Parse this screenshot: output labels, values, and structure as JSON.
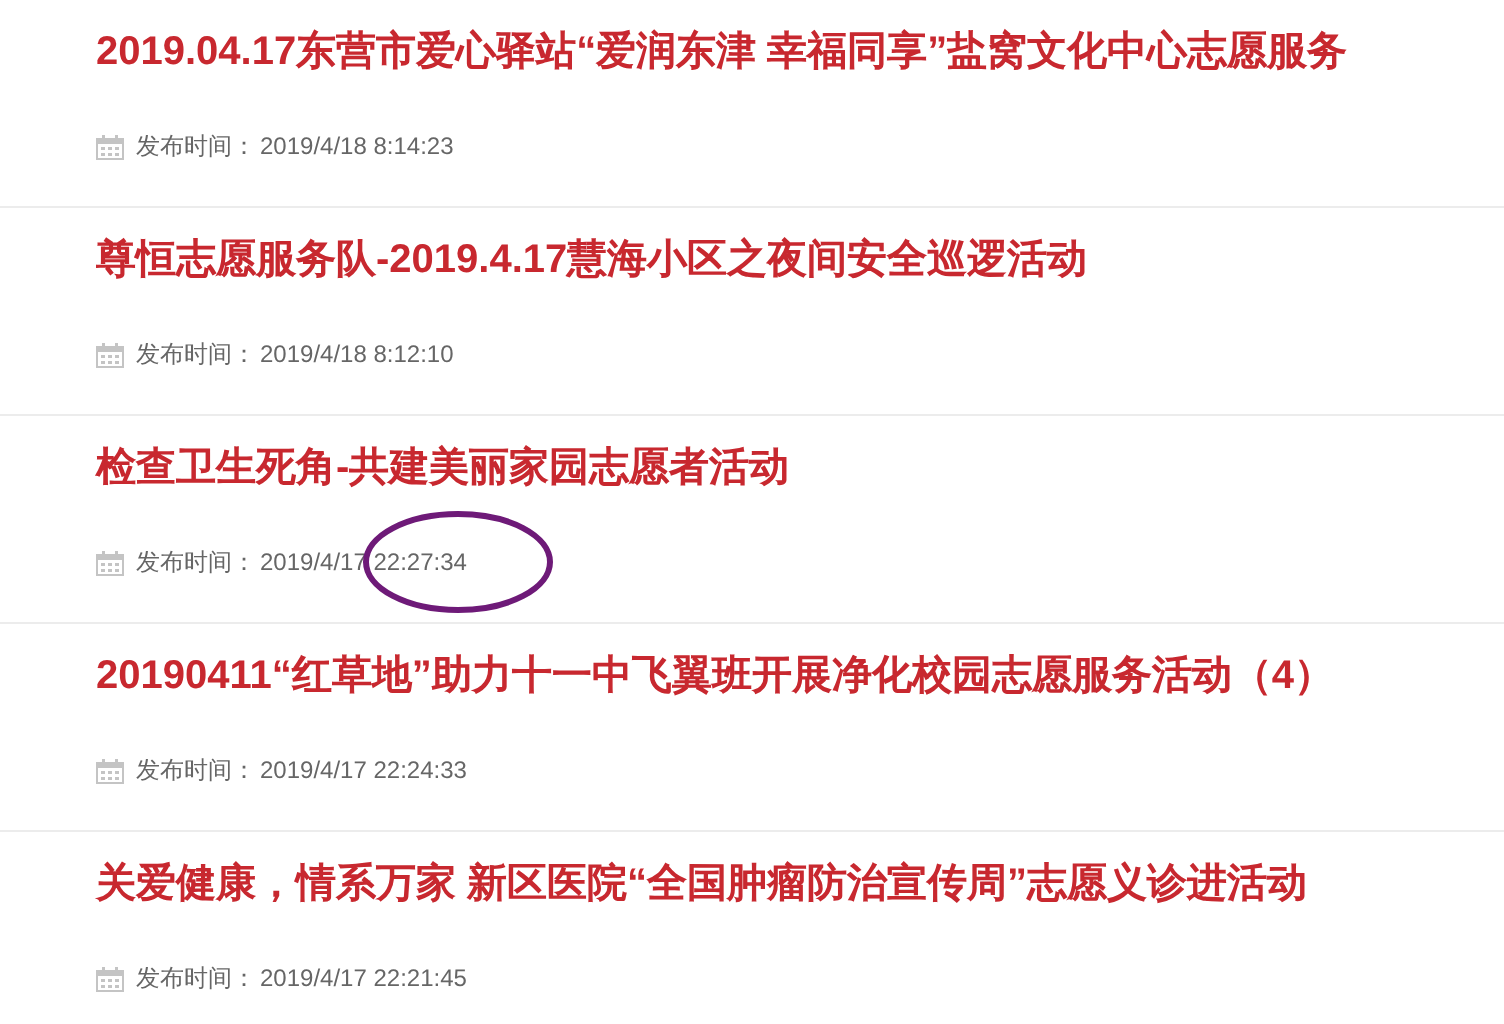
{
  "news": [
    {
      "title": "2019.04.17东营市爱心驿站“爱润东津 幸福同享”盐窝文化中心志愿服务",
      "date_label": "发布时间：",
      "date": "2019/4/18 8:14:23",
      "circled": false
    },
    {
      "title": "尊恒志愿服务队-2019.4.17慧海小区之夜间安全巡逻活动",
      "date_label": "发布时间：",
      "date": "2019/4/18 8:12:10",
      "circled": false
    },
    {
      "title": "检查卫生死角-共建美丽家园志愿者活动",
      "date_label": "发布时间：",
      "date": "2019/4/17 22:27:34",
      "circled": true
    },
    {
      "title": "20190411“红草地”助力十一中飞翼班开展净化校园志愿服务活动（4）",
      "date_label": "发布时间：",
      "date": "2019/4/17 22:24:33",
      "circled": false
    },
    {
      "title": "关爱健康，情系万家 新区医院“全国肿瘤防治宣传周”志愿义诊进活动",
      "date_label": "发布时间：",
      "date": "2019/4/17 22:21:45",
      "circled": false
    }
  ]
}
